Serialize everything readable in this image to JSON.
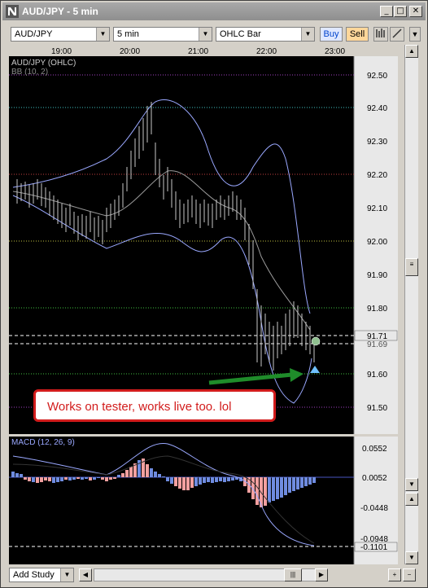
{
  "window": {
    "title": "AUD/JPY - 5 min"
  },
  "toolbar": {
    "symbol": "AUD/JPY",
    "timeframe": "5 min",
    "chart_type": "OHLC Bar",
    "buy_label": "Buy",
    "sell_label": "Sell"
  },
  "price_panel": {
    "label_symbol": "AUD/JPY (OHLC)",
    "label_indicator": "BB (10, 2)",
    "price_ticks": [
      "92.50",
      "92.40",
      "92.30",
      "92.20",
      "92.10",
      "92.00",
      "91.90",
      "91.80",
      "91.71",
      "91.69",
      "91.60",
      "91.50"
    ],
    "current_price": "91.71",
    "cursor_price": "91.69"
  },
  "time_axis": {
    "ticks": [
      "19:00",
      "20:00",
      "21:00",
      "22:00",
      "23:00"
    ]
  },
  "macd_panel": {
    "label": "MACD (12, 26, 9)",
    "ticks": [
      "0.0552",
      "0.0052",
      "-0.0448",
      "-0.0948",
      "-0.1101"
    ]
  },
  "annotation": {
    "text": "Works on tester, works live too. lol"
  },
  "bottom_bar": {
    "add_study_label": "Add Study"
  },
  "colors": {
    "chart_bg": "#000000",
    "bars": "#c8c8c8",
    "bb": "#9aa8ff",
    "macd_pos": "#6f8ce0",
    "macd_neg": "#f2a0a0",
    "annotation": "#d21c1c",
    "arrow": "#1f8c2a"
  }
}
